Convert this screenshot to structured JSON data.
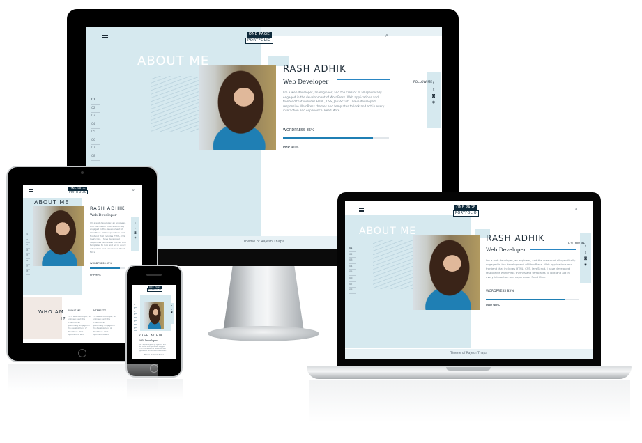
{
  "logo": {
    "line1": "ONE PAGE",
    "line2": "PORTFOLIO"
  },
  "hero": {
    "ghost_title": "ABOUT ME",
    "name": "RASH ADHIK",
    "role": "Web Developer",
    "bio": "I'm a web developer, an engineer, and the creator of all specifically engaged in the development of WordPress. Web applications and frontend that includes HTML, CSS, JavaScript. I have developed responsive WordPress themes and templates to look and act in every interaction and experience. Read More"
  },
  "skills": [
    {
      "label": "WORDPRESS 85%",
      "percent": 85
    },
    {
      "label": "PHP 90%",
      "percent": 90
    }
  ],
  "follow": {
    "label": "FOLLOW ME",
    "icons": [
      "facebook-icon",
      "twitter-icon",
      "instagram-icon",
      "github-icon"
    ]
  },
  "section_numbers": [
    "01",
    "02",
    "03",
    "04",
    "05",
    "06",
    "07",
    "08"
  ],
  "second_section": {
    "title_part1": "WHO AM",
    "title_part2": "I?",
    "col1": "ABOUT ME",
    "col2": "INTERESTS"
  },
  "footer": {
    "text": "Theme of Rajesh Thapa"
  },
  "colors": {
    "accent": "#1f7fb4",
    "pale_blue": "#d6e9ef",
    "navy": "#0e2a3b"
  }
}
